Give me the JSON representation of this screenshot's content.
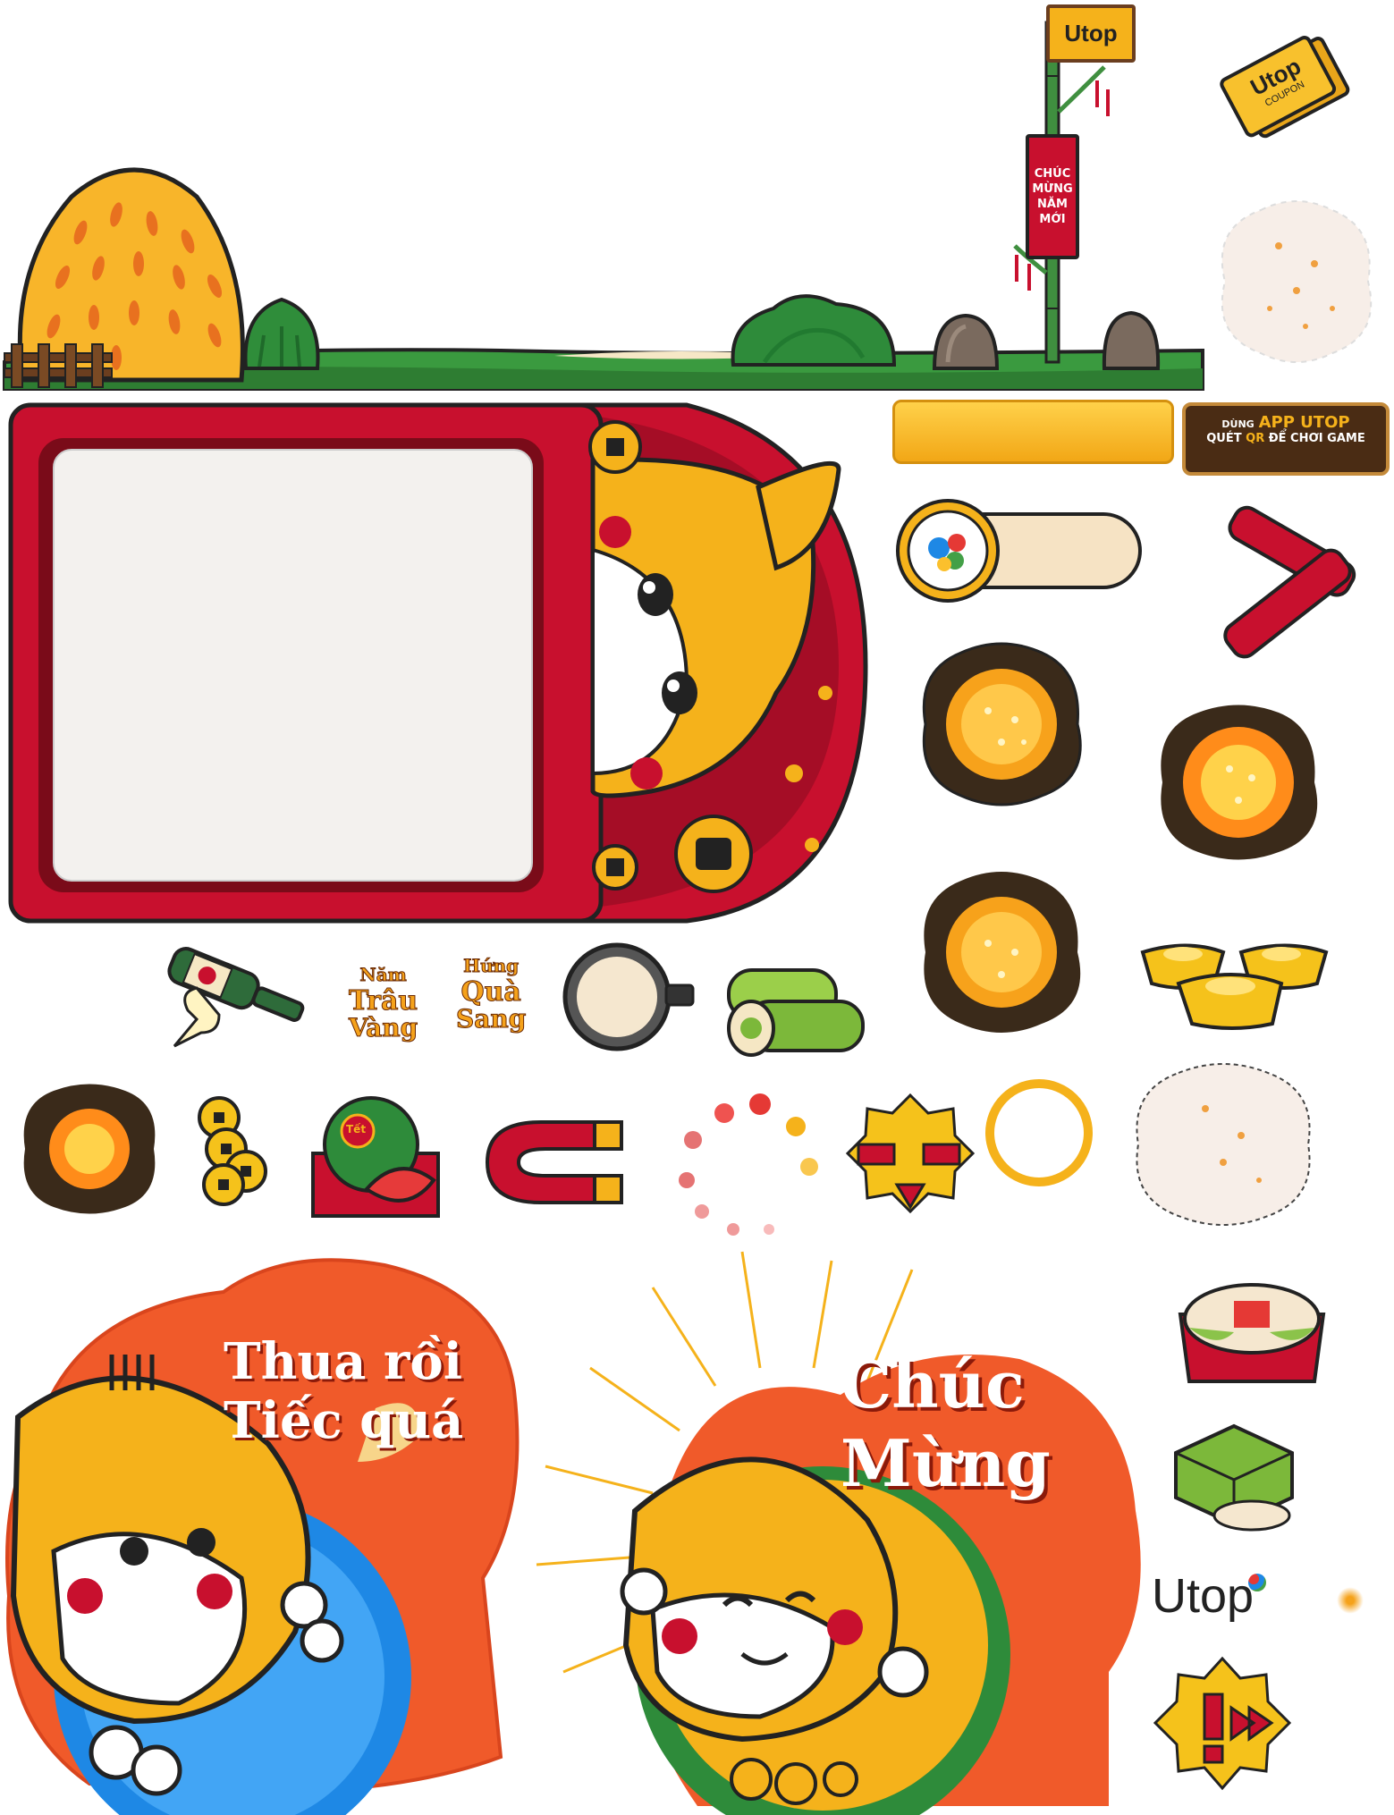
{
  "brand": {
    "logo_text": "Utop",
    "coupon_text": "COUPON",
    "colors": {
      "red": "#c8102e",
      "gold": "#f5b21b",
      "green": "#2e8b3a",
      "orange": "#f07a2a"
    }
  },
  "signpost": {
    "logo_text": "Utop",
    "banner_lines": [
      "CHÚC",
      "MỪNG",
      "NĂM",
      "MỚI"
    ]
  },
  "qr_sign": {
    "line1_prefix": "DÙNG",
    "line1_highlight": "APP UTOP",
    "line2_prefix": "QUÉT",
    "line2_highlight": "QR",
    "line2_suffix": "ĐỂ CHƠI GAME"
  },
  "title_badge": {
    "col1": [
      "Năm",
      "Trâu",
      "Vàng"
    ],
    "col2": [
      "Hứng",
      "Quà",
      "Sang"
    ]
  },
  "watermelon": {
    "label": "Tết"
  },
  "lose_panel": {
    "line1": "Thua rồi",
    "line2": "Tiếc quá"
  },
  "win_panel": {
    "line1": "Chúc",
    "line2": "Mừng"
  },
  "icons": [
    "haystack-icon",
    "bush-icon",
    "rock-icon",
    "bamboo-pole-icon",
    "coupon-icon",
    "firework-icon",
    "progress-bar-icon",
    "toggle-icon",
    "firecracker-icon",
    "explosion-icon",
    "gold-ingot-icon",
    "champagne-icon",
    "pan-icon",
    "banh-tet-icon",
    "gold-coins-icon",
    "watermelon-icon",
    "magnet-icon",
    "loading-spinner-icon",
    "alert-badge-icon",
    "ring-icon",
    "tray-icon",
    "banh-chung-icon",
    "speed-badge-icon"
  ]
}
